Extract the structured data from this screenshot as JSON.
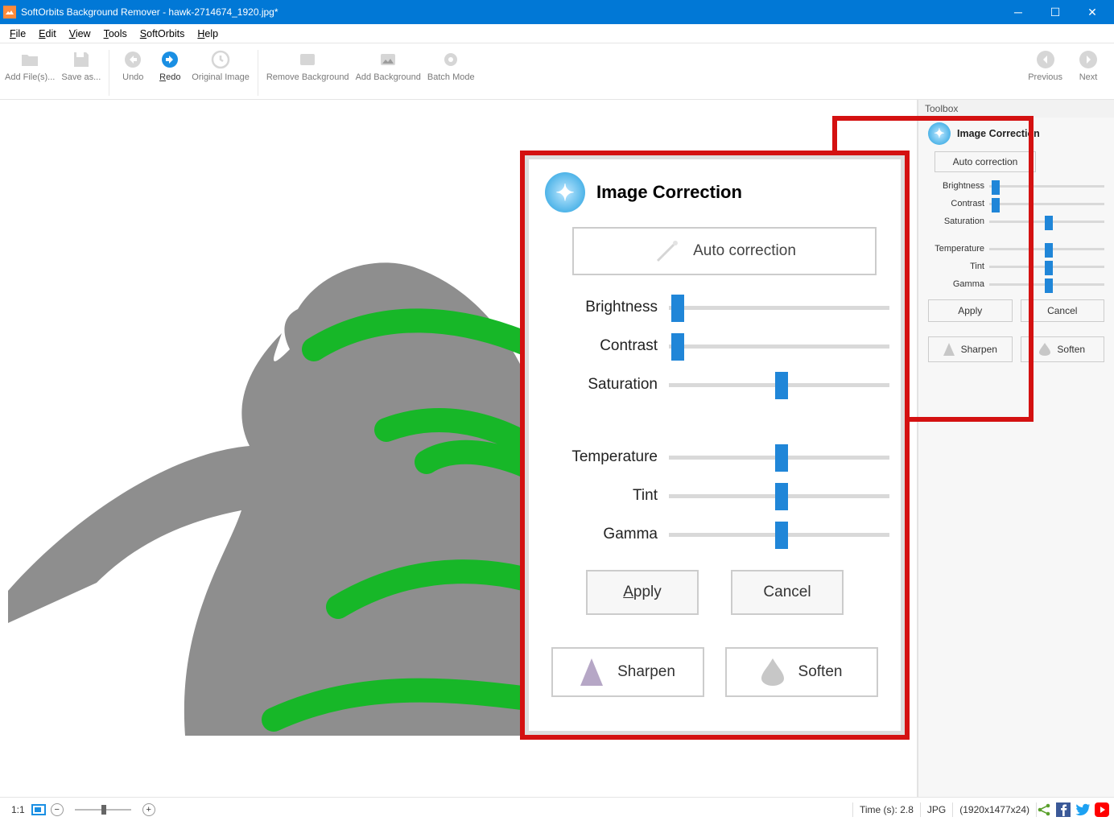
{
  "window": {
    "title": "SoftOrbits Background Remover - hawk-2714674_1920.jpg*"
  },
  "menu": {
    "file": "File",
    "edit": "Edit",
    "view": "View",
    "tools": "Tools",
    "softorbits": "SoftOrbits",
    "help": "Help"
  },
  "ribbon": {
    "add_files": "Add File(s)...",
    "save_as": "Save as...",
    "undo": "Undo",
    "redo": "Redo",
    "original_image": "Original Image",
    "remove_bg": "Remove Background",
    "add_bg": "Add Background",
    "batch_mode": "Batch Mode",
    "previous": "Previous",
    "next": "Next"
  },
  "toolbox": {
    "header": "Toolbox"
  },
  "image_correction": {
    "title": "Image Correction",
    "auto": "Auto correction",
    "sliders": {
      "brightness": {
        "label": "Brightness",
        "pos": 2
      },
      "contrast": {
        "label": "Contrast",
        "pos": 2
      },
      "saturation": {
        "label": "Saturation",
        "pos": 50
      },
      "temperature": {
        "label": "Temperature",
        "pos": 50
      },
      "tint": {
        "label": "Tint",
        "pos": 50
      },
      "gamma": {
        "label": "Gamma",
        "pos": 50
      }
    },
    "apply": "Apply",
    "cancel": "Cancel",
    "sharpen": "Sharpen",
    "soften": "Soften"
  },
  "status": {
    "ratio": "1:1",
    "time_label": "Time (s):",
    "time_value": "2.8",
    "format": "JPG",
    "dimensions": "(1920x1477x24)"
  }
}
